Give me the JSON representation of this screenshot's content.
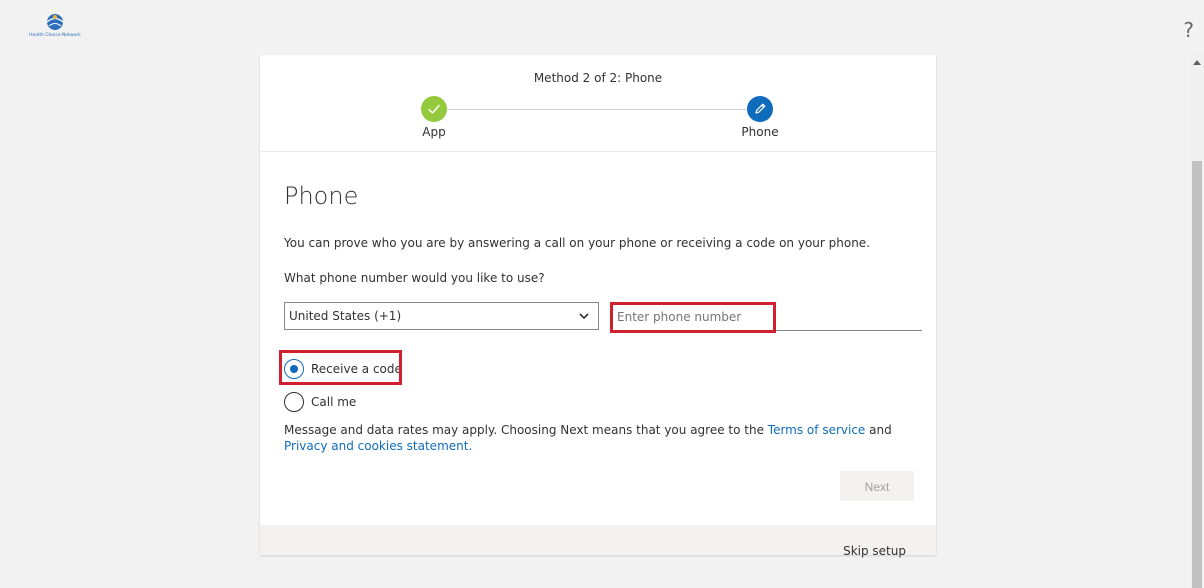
{
  "header": {
    "logo_text": "Health Choice Network",
    "help_glyph": "?"
  },
  "steps": {
    "title": "Method 2 of 2: Phone",
    "items": [
      {
        "label": "App",
        "state": "complete"
      },
      {
        "label": "Phone",
        "state": "current"
      }
    ]
  },
  "phone_section": {
    "title": "Phone",
    "description": "You can prove who you are by answering a call on your phone or receiving a code on your phone.",
    "question": "What phone number would you like to use?",
    "country_select": {
      "selected": "United States (+1)"
    },
    "phone_input": {
      "value": "",
      "placeholder": "Enter phone number"
    },
    "options": [
      {
        "label": "Receive a code",
        "checked": true
      },
      {
        "label": "Call me",
        "checked": false
      }
    ],
    "disclaimer": {
      "prefix": "Message and data rates may apply. Choosing Next means that you agree to the ",
      "terms_link": "Terms of service",
      "and_text": " and ",
      "privacy_link": "Privacy and cookies statement.",
      "suffix": ""
    },
    "next_label": "Next"
  },
  "footer": {
    "skip_label": "Skip setup"
  },
  "colors": {
    "accent": "#0f6cbd",
    "success": "#94c93d",
    "highlight": "#d1202f"
  }
}
